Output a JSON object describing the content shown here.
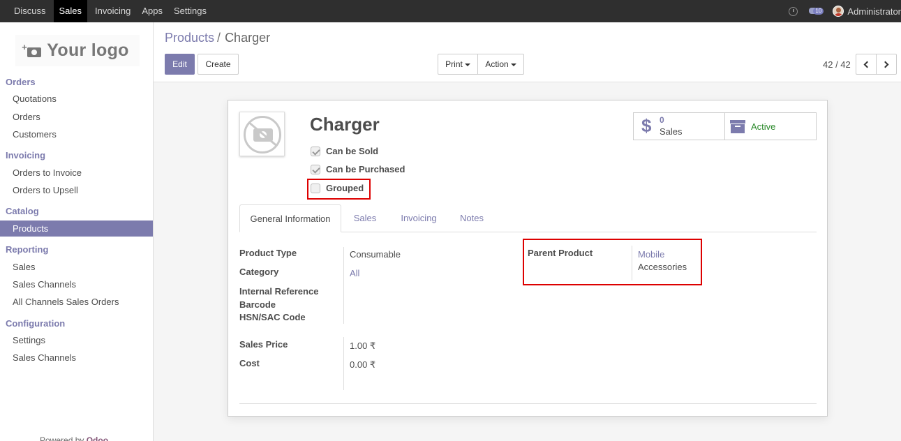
{
  "topbar": {
    "menu": [
      "Discuss",
      "Sales",
      "Invoicing",
      "Apps",
      "Settings"
    ],
    "active": "Sales",
    "notification_count": "10",
    "user": "Administrator"
  },
  "sidebar": {
    "logo_text": "Your logo",
    "sections": [
      {
        "title": "Orders",
        "items": [
          "Quotations",
          "Orders",
          "Customers"
        ]
      },
      {
        "title": "Invoicing",
        "items": [
          "Orders to Invoice",
          "Orders to Upsell"
        ]
      },
      {
        "title": "Catalog",
        "items": [
          "Products"
        ]
      },
      {
        "title": "Reporting",
        "items": [
          "Sales",
          "Sales Channels",
          "All Channels Sales Orders"
        ]
      },
      {
        "title": "Configuration",
        "items": [
          "Settings",
          "Sales Channels"
        ]
      }
    ],
    "active_item": "Products",
    "powered_by": "Powered by",
    "powered_brand": "Odoo"
  },
  "control": {
    "breadcrumb_parent": "Products",
    "breadcrumb_sep": "/",
    "breadcrumb_current": "Charger",
    "edit_label": "Edit",
    "create_label": "Create",
    "print_label": "Print",
    "action_label": "Action",
    "pager": "42 / 42"
  },
  "form": {
    "name": "Charger",
    "checkboxes": [
      {
        "label": "Can be Sold",
        "checked": true
      },
      {
        "label": "Can be Purchased",
        "checked": true
      },
      {
        "label": "Grouped",
        "checked": false
      }
    ],
    "stat_sales_count": "0",
    "stat_sales_label": "Sales",
    "stat_active_label": "Active",
    "tabs": [
      "General Information",
      "Sales",
      "Invoicing",
      "Notes"
    ],
    "active_tab": "General Information",
    "fields_left": {
      "product_type_label": "Product Type",
      "product_type_value": "Consumable",
      "category_label": "Category",
      "category_value": "All",
      "internal_ref_label": "Internal Reference",
      "barcode_label": "Barcode",
      "hsn_label": "HSN/SAC Code",
      "sales_price_label": "Sales Price",
      "sales_price_value": "1.00 ₹",
      "cost_label": "Cost",
      "cost_value": "0.00 ₹"
    },
    "fields_right": {
      "parent_product_label": "Parent Product",
      "parent_product_value_line1": "Mobile",
      "parent_product_value_line2": "Accessories"
    }
  },
  "colors": {
    "accent": "#7c7bad",
    "topbar": "#2f2f2f",
    "highlight": "#dd0000",
    "active_status": "#2c8a2c"
  }
}
